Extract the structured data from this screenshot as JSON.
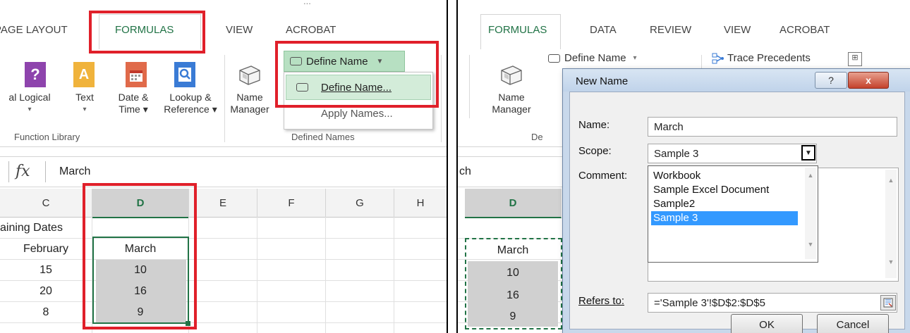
{
  "left": {
    "tabs": [
      "PAGE LAYOUT",
      "FORMULAS",
      "VIEW",
      "ACROBAT"
    ],
    "title_fragment": "...",
    "ribbon_buttons": [
      {
        "line1": "al Logical",
        "line2": "▾",
        "icon": "logical-icon"
      },
      {
        "line1": "Text",
        "line2": "▾",
        "icon": "text-icon"
      },
      {
        "line1": "Date &",
        "line2": "Time ▾",
        "icon": "date-time-icon"
      },
      {
        "line1": "Lookup &",
        "line2": "Reference ▾",
        "icon": "lookup-reference-icon"
      },
      {
        "line1": "Name",
        "line2": "Manager",
        "icon": "name-manager-icon"
      }
    ],
    "function_library_label": "Function Library",
    "define_name_button": "Define Name",
    "define_name_menu": [
      "Define Name...",
      "Apply Names..."
    ],
    "defined_names_label": "Defined Names",
    "fx": "fx",
    "formula_value": "March",
    "columns": [
      "C",
      "D",
      "E",
      "F",
      "G",
      "H"
    ],
    "rows": [
      [
        "aining Dates",
        "",
        "",
        "",
        "",
        ""
      ],
      [
        "February",
        "March",
        "",
        "",
        "",
        ""
      ],
      [
        "15",
        "10",
        "",
        "",
        "",
        ""
      ],
      [
        "20",
        "16",
        "",
        "",
        "",
        ""
      ],
      [
        "8",
        "9",
        "",
        "",
        "",
        ""
      ]
    ]
  },
  "right": {
    "tabs": [
      "FORMULAS",
      "DATA",
      "REVIEW",
      "VIEW",
      "ACROBAT"
    ],
    "define_name_button": "Define Name",
    "trace_precedents": "Trace Precedents",
    "name_manager": {
      "line1": "Name",
      "line2": "Manager"
    },
    "group_fragment": "De",
    "formula_fragment": "ch",
    "column": "D",
    "cells": [
      "March",
      "10",
      "16",
      "9"
    ],
    "dialog": {
      "title": "New Name",
      "help": "?",
      "close": "x",
      "name_label": "Name:",
      "name_value": "March",
      "scope_label": "Scope:",
      "scope_value": "Sample 3",
      "comment_label": "Comment:",
      "scope_options": [
        "Workbook",
        "Sample Excel Document",
        "Sample2",
        "Sample 3"
      ],
      "selected_option": "Sample 3",
      "refers_label": "Refers to:",
      "refers_value": "='Sample 3'!$D$2:$D$5",
      "ok": "OK",
      "cancel": "Cancel"
    }
  },
  "colors": {
    "excel_green": "#217346",
    "highlight_red": "#e0202a",
    "selection_blue": "#3399ff"
  }
}
